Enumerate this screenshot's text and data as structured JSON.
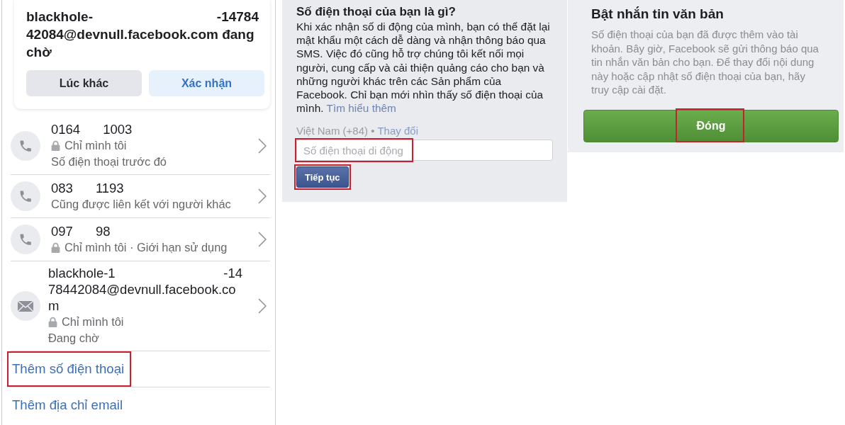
{
  "confirm_card": {
    "title_start": "blackhole-",
    "title_end": "-14784",
    "title_rest": "42084@devnull.facebook.com đang chờ",
    "buttons": [
      {
        "label": "Lúc khác",
        "kind": "secondary"
      },
      {
        "label": "Xác nhận",
        "kind": "primary"
      }
    ]
  },
  "contacts": [
    {
      "kind": "phone",
      "value_parts": [
        "0164",
        "1003"
      ],
      "audience": "Chỉ mình tôi",
      "note": "Số điện thoại trước đó"
    },
    {
      "kind": "phone",
      "value_parts": [
        "083",
        "1193"
      ],
      "note": "Cũng được liên kết với người khác"
    },
    {
      "kind": "phone",
      "value_parts": [
        "097",
        "98"
      ],
      "audience": "Chỉ mình tôi · Giới hạn sử dụng"
    },
    {
      "kind": "email",
      "value_parts": [
        "blackhole-1",
        "-14"
      ],
      "value_rest": "78442084@devnull.facebook.com",
      "audience": "Chỉ mình tôi",
      "note": "Đang chờ"
    }
  ],
  "links": [
    {
      "label": "Thêm số điện thoại",
      "highlighted": true
    },
    {
      "label": "Thêm địa chỉ email",
      "highlighted": false
    }
  ],
  "phone_form": {
    "title": "Số điện thoại của bạn là gì?",
    "description": "Khi xác nhận số di động của mình, bạn có thể đặt lại mật khẩu một cách dễ dàng và nhận thông báo qua SMS. Việc đó cũng hỗ trợ chúng tôi kết nối mọi người, cung cấp và cải thiện quảng cáo cho bạn và những người khác trên các Sản phẩm của Facebook. Chỉ bạn mới nhìn thấy số điện thoại của mình.",
    "learn_more": "Tìm hiểu thêm",
    "country": "Việt Nam (+84) •",
    "change_link": "Thay đổi",
    "input": {
      "placeholder": "Số điện thoại di động",
      "highlighted": true
    },
    "submit": {
      "label": "Tiếp tục",
      "highlighted": true
    }
  },
  "sms_dialog": {
    "title": "Bật nhắn tin văn bản",
    "message": "Số điện thoại của bạn đã được thêm vào tài khoản. Bây giờ, Facebook sẽ gửi thông báo qua tin nhắn văn bản cho bạn. Để thay đổi nội dung này hoặc cập nhật số điện thoại của bạn, hãy truy cập cài đặt.",
    "button": {
      "label": "Đóng",
      "highlighted": true
    }
  }
}
